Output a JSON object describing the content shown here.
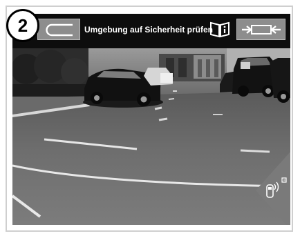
{
  "step": {
    "number": "2"
  },
  "header": {
    "title": "Umgebung auf Sicherheit prüfen",
    "back_icon": "back-arrow-icon",
    "info_icon": "book-info-icon",
    "forward_icon": "camera-switch-icon"
  },
  "camera": {
    "view": "rear-camera-parking-view",
    "sensor_icon": "parking-sensor-icon"
  },
  "colors": {
    "topbar": "#0d0d0d",
    "button": "#8d8d8d",
    "sensor_tab": "#7a7a7a"
  }
}
